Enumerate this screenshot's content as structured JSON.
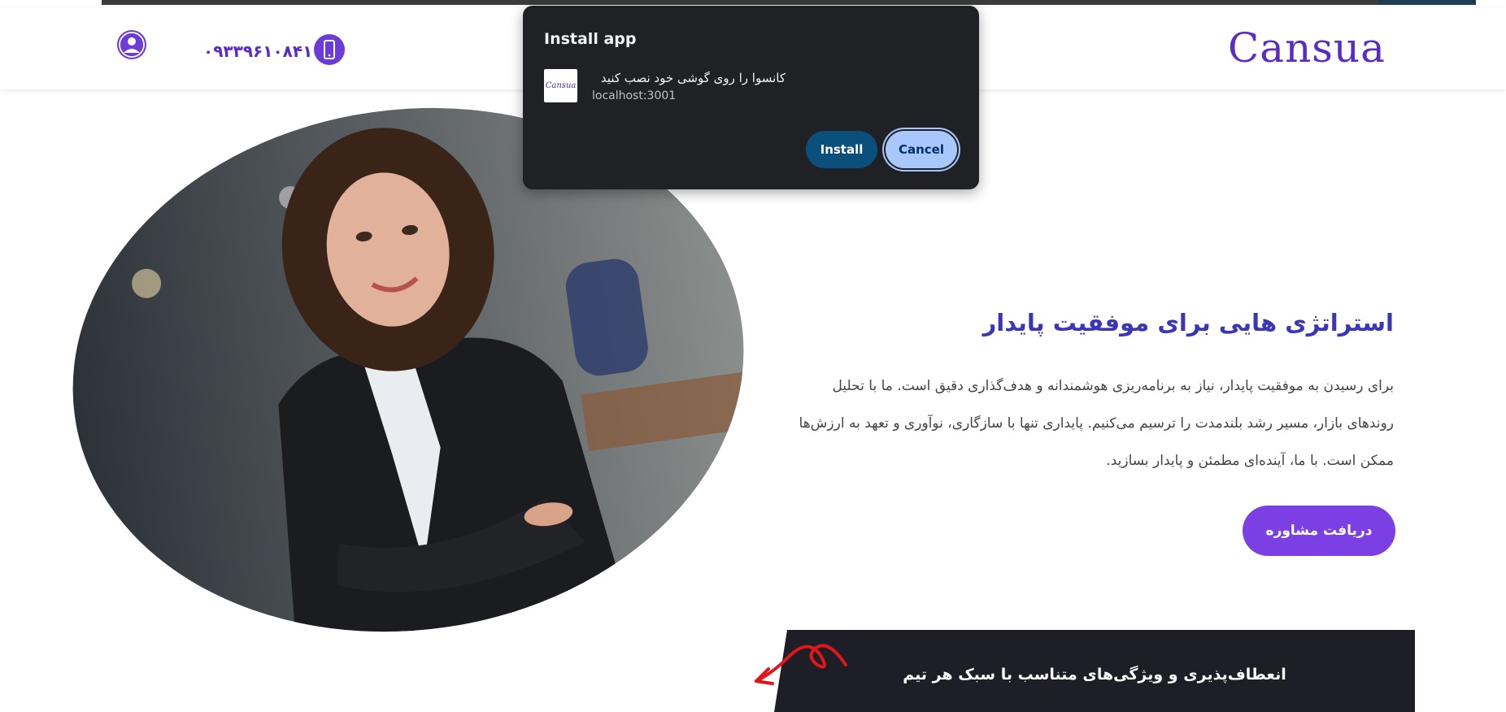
{
  "header": {
    "phone": "۰۹۳۳۹۶۱۰۸۴۱",
    "logo": "Cansua"
  },
  "hero": {
    "title": "استراتژی هایی برای موفقیت پایدار",
    "body_line1": "برای رسیدن به موفقیت پایدار، نیاز به برنامه‌ریزی هوشمندانه و هدف‌گذاری دقیق است. ما با تحلیل",
    "body_line2": "روندهای بازار، مسیر رشد بلندمدت را ترسیم می‌کنیم. پایداری تنها با سازگاری، نوآوری و تعهد به ارزش‌ها",
    "body_line3": "ممکن است. با ما، آینده‌ای مطمئن و پایدار بسازید.",
    "cta_label": "دریافت مشاوره"
  },
  "feature": {
    "text": "انعطاف‌پذیری و ویژگی‌های متناسب با سبک هر تیم"
  },
  "install_dialog": {
    "title": "Install app",
    "app_icon_text": "Cansua",
    "app_name": "کانسوا را روی گوشی خود نصب کنید",
    "app_url": "localhost:3001",
    "install_label": "Install",
    "cancel_label": "Cancel"
  },
  "icons": {
    "user": "user-icon",
    "phone": "mobile-phone-icon"
  },
  "colors": {
    "brand": "#5b2bc7",
    "cta": "#7b3fe4",
    "dialog_bg": "#202124",
    "install_btn": "#0b4f7c",
    "cancel_btn": "#a8c7fa",
    "feature_band": "#1d1e26"
  }
}
